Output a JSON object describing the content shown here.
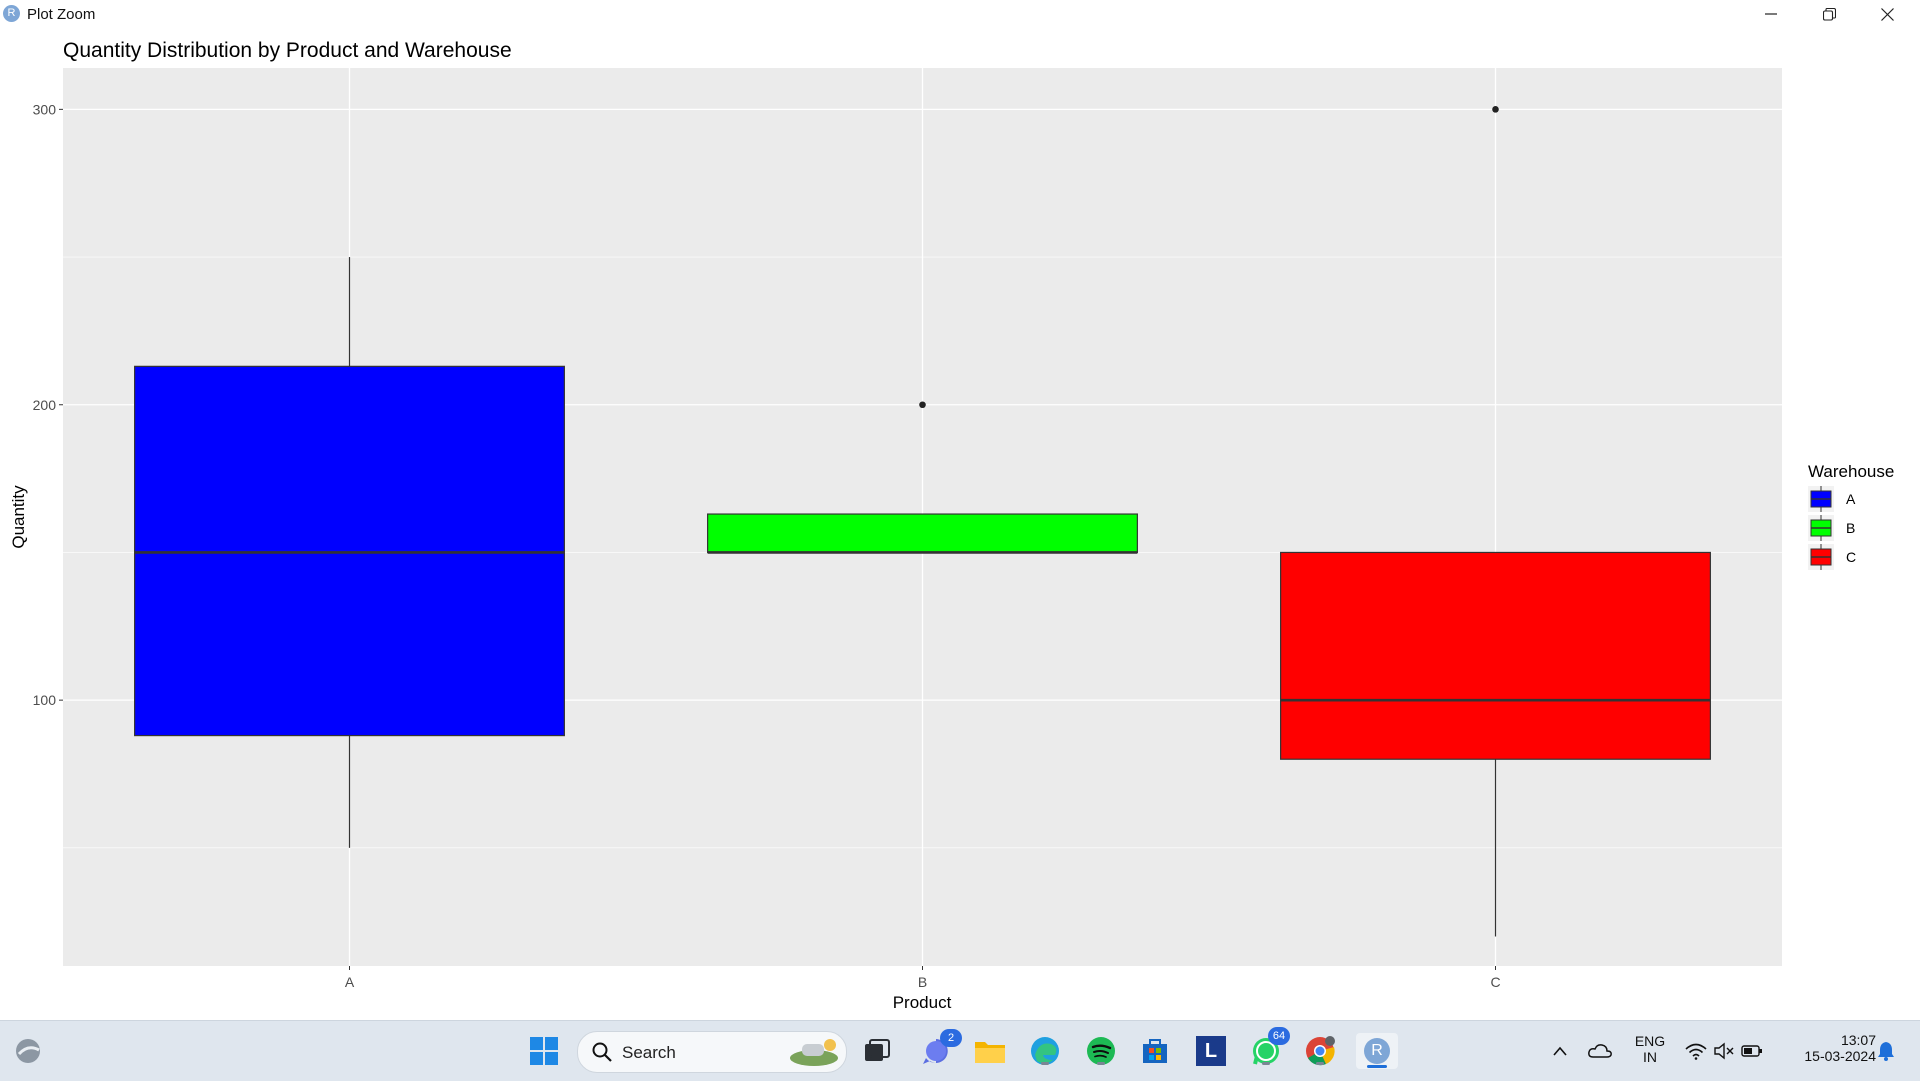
{
  "window": {
    "title": "Plot Zoom",
    "app_icon_letter": "R"
  },
  "chart_data": {
    "type": "boxplot",
    "title": "Quantity Distribution by Product and Warehouse",
    "xlabel": "Product",
    "ylabel": "Quantity",
    "categories": [
      "A",
      "B",
      "C"
    ],
    "ylim": [
      10,
      314
    ],
    "yticks": [
      100,
      200,
      300
    ],
    "grid": true,
    "legend": {
      "title": "Warehouse",
      "placement": "right",
      "entries": [
        {
          "label": "A",
          "color": "#0000ff"
        },
        {
          "label": "B",
          "color": "#00ff00"
        },
        {
          "label": "C",
          "color": "#ff0000"
        }
      ]
    },
    "boxes": [
      {
        "category": "A",
        "warehouse": "A",
        "color": "#0000ff",
        "whisker_low": 50,
        "q1": 88,
        "median": 150,
        "q3": 213,
        "whisker_high": 250,
        "outliers": []
      },
      {
        "category": "B",
        "warehouse": "B",
        "color": "#00ff00",
        "whisker_low": 150,
        "q1": 150,
        "median": 150,
        "q3": 163,
        "whisker_high": 163,
        "outliers": [
          200
        ]
      },
      {
        "category": "C",
        "warehouse": "C",
        "color": "#ff0000",
        "whisker_low": 20,
        "q1": 80,
        "median": 100,
        "q3": 150,
        "whisker_high": 150,
        "outliers": [
          300
        ]
      }
    ]
  },
  "taskbar": {
    "search_label": "Search",
    "teams_badge": "2",
    "whatsapp_badge": "64",
    "store_letter": "L",
    "r_letter": "R",
    "language_line1": "ENG",
    "language_line2": "IN",
    "time": "13:07",
    "date": "15-03-2024"
  }
}
